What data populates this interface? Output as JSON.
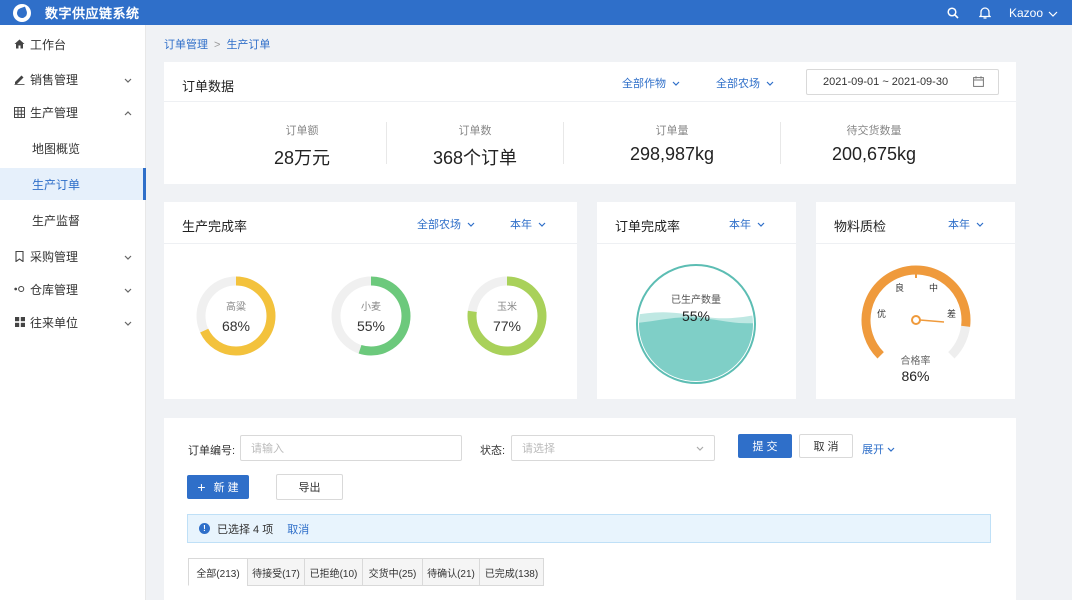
{
  "app": {
    "title": "数字供应链系统",
    "user": "Kazoo"
  },
  "colors": {
    "primary": "#2f6fc9",
    "sorghum": "#f3c23c",
    "wheat": "#6cc97c",
    "corn": "#a9d15a",
    "gauge": "#ef9a3c",
    "wave": "#7fcfc7"
  },
  "sidebar": {
    "items": [
      {
        "label": "工作台",
        "icon": "home-icon"
      },
      {
        "label": "销售管理",
        "icon": "pen-icon"
      },
      {
        "label": "生产管理",
        "icon": "grid-icon"
      },
      {
        "label": "采购管理",
        "icon": "bookmark-icon"
      },
      {
        "label": "仓库管理",
        "icon": "warehouse-icon"
      },
      {
        "label": "往来单位",
        "icon": "apps-icon"
      }
    ],
    "sub": [
      "地图概览",
      "生产订单",
      "生产监督"
    ]
  },
  "breadcrumb": {
    "parent": "订单管理",
    "current": "生产订单"
  },
  "order_data": {
    "title": "订单数据",
    "filter_crop": "全部作物",
    "filter_farm": "全部农场",
    "date_range": "2021-09-01 ~ 2021-09-30",
    "stats": [
      {
        "label": "订单额",
        "value": "28万元"
      },
      {
        "label": "订单数",
        "value": "368个订单"
      },
      {
        "label": "订单量",
        "value": "298,987kg"
      },
      {
        "label": "待交货数量",
        "value": "200,675kg"
      }
    ]
  },
  "production": {
    "title": "生产完成率",
    "filter_farm": "全部农场",
    "filter_year": "本年",
    "items": [
      {
        "name": "高粱",
        "value": "68%",
        "percent": 68
      },
      {
        "name": "小麦",
        "value": "55%",
        "percent": 55
      },
      {
        "name": "玉米",
        "value": "77%",
        "percent": 77
      }
    ]
  },
  "order_completion": {
    "title": "订单完成率",
    "filter_year": "本年",
    "label": "已生产数量",
    "value": "55%",
    "percent": 55
  },
  "quality": {
    "title": "物料质检",
    "filter_year": "本年",
    "grades": [
      "优",
      "良",
      "中",
      "差"
    ],
    "label": "合格率",
    "value": "86%",
    "percent": 86
  },
  "form": {
    "order_no_label": "订单编号:",
    "order_no_placeholder": "请输入",
    "status_label": "状态:",
    "status_placeholder": "请选择",
    "submit": "提 交",
    "cancel": "取 消",
    "expand": "展开",
    "new": "新 建",
    "export": "导出",
    "selected": "已选择 4 项",
    "cancel_select": "取消"
  },
  "tabs": [
    "全部(213)",
    "待接受(17)",
    "已拒绝(10)",
    "交货中(25)",
    "待确认(21)",
    "已完成(138)"
  ]
}
